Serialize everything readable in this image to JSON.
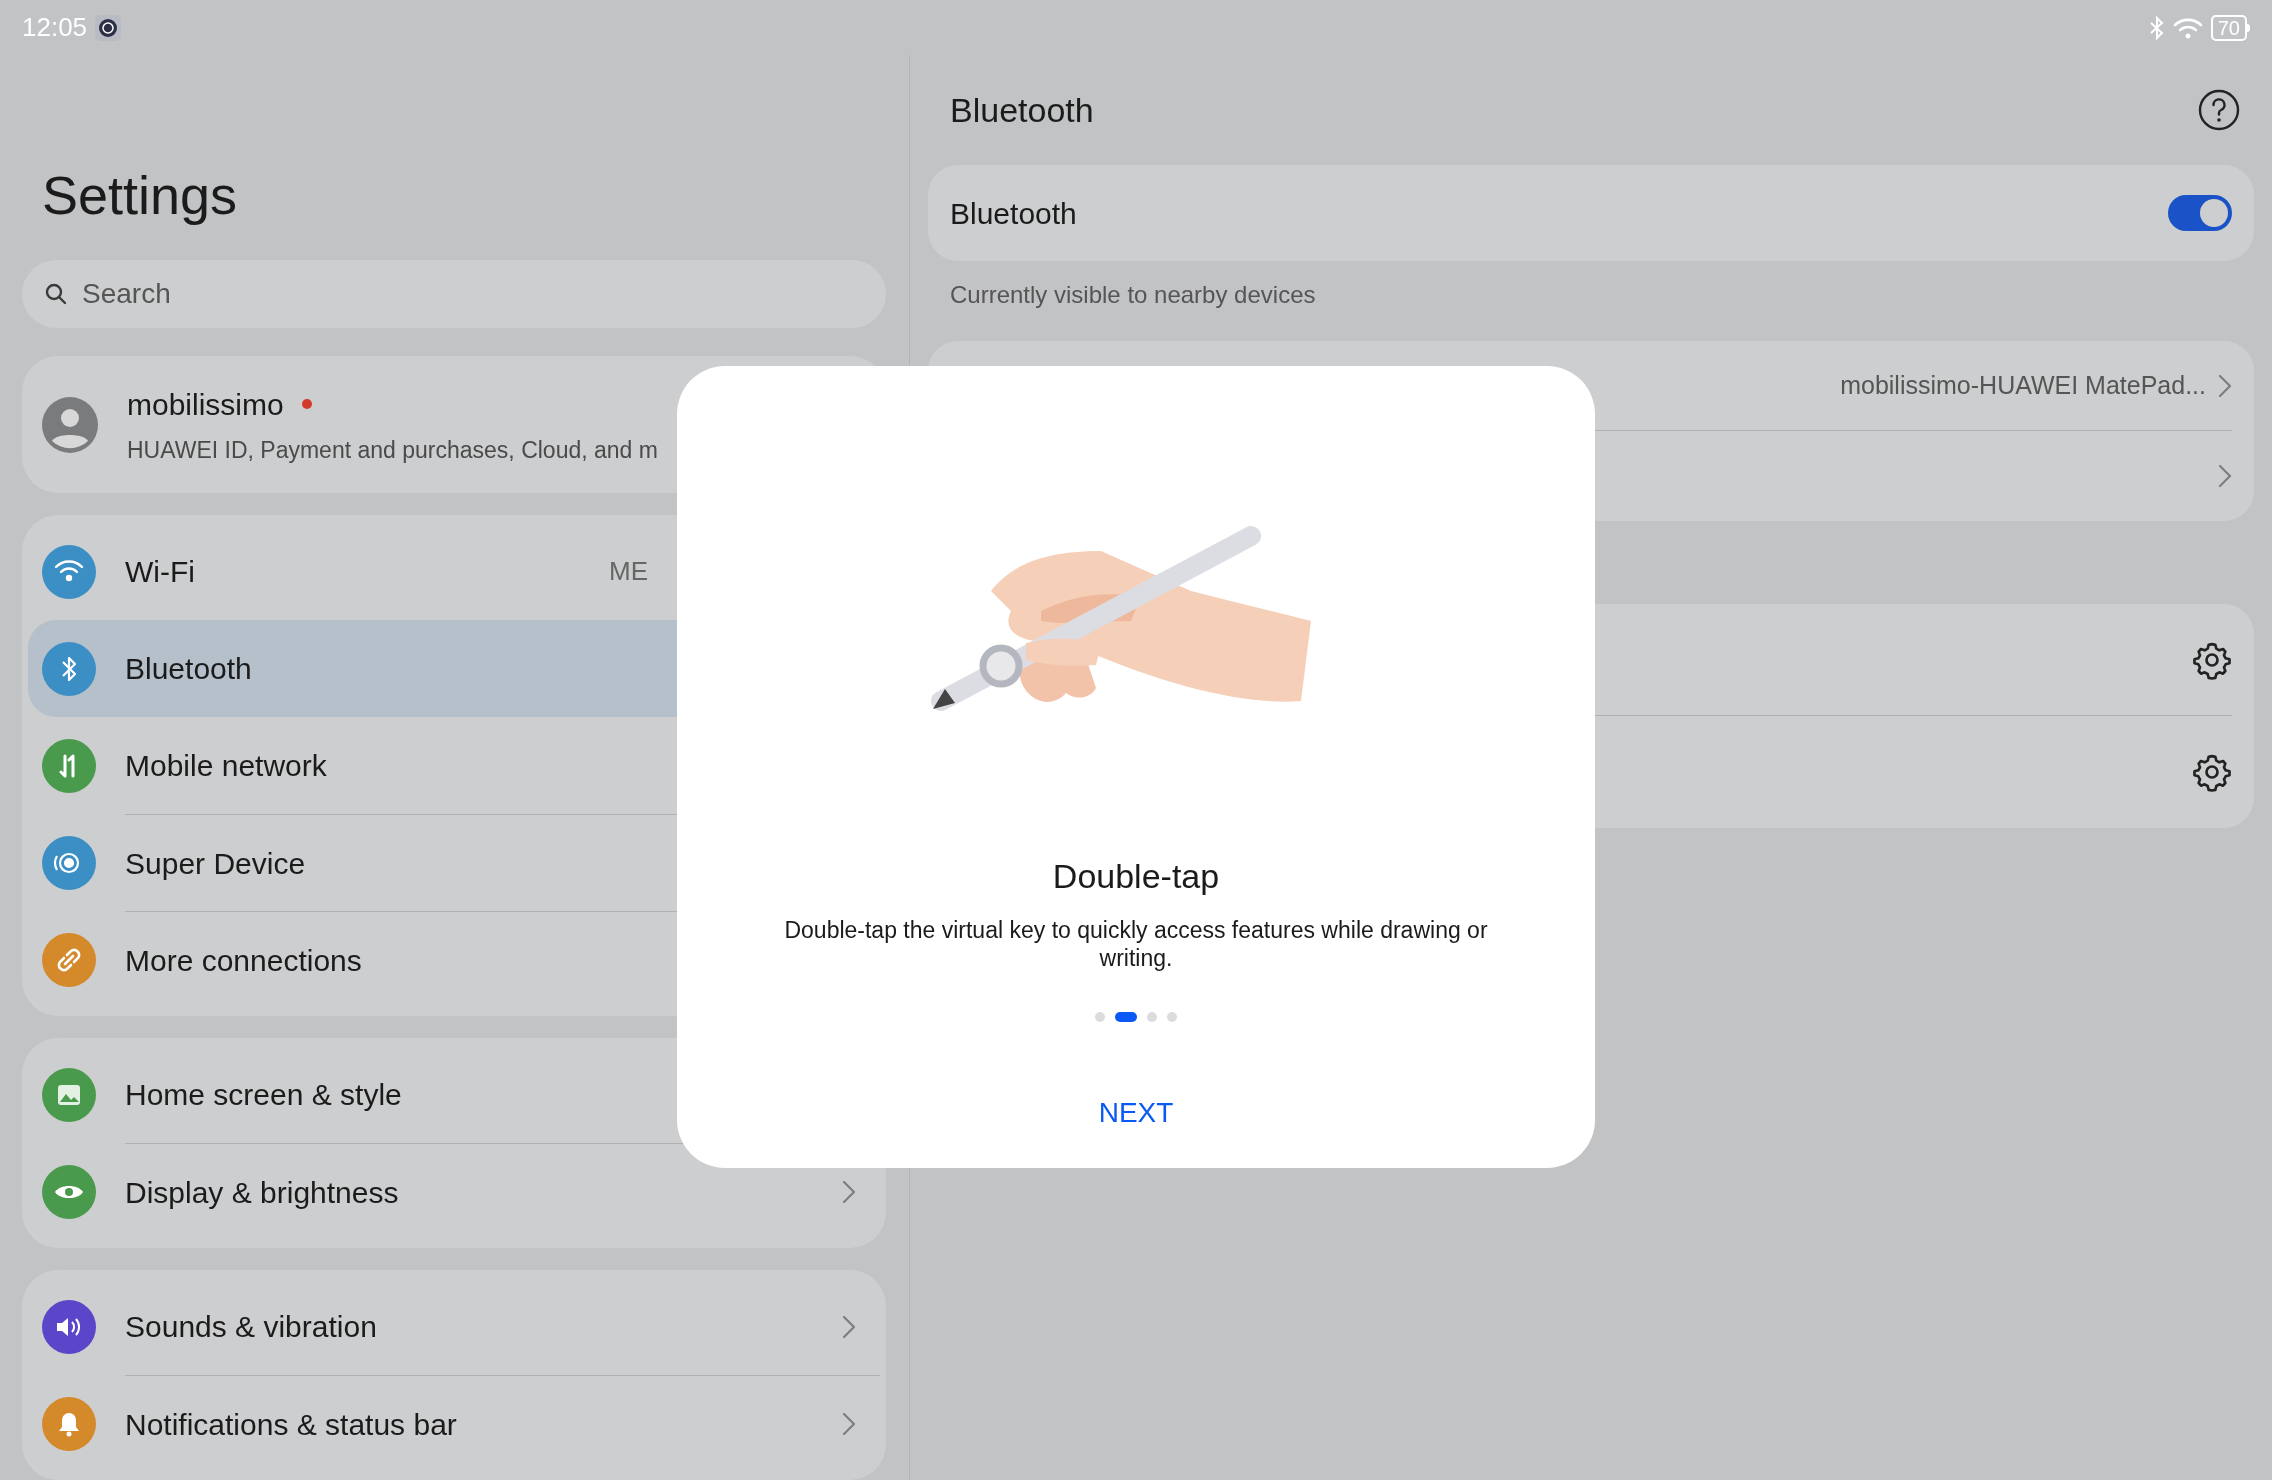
{
  "status_bar": {
    "time": "12:05",
    "battery": "70"
  },
  "settings": {
    "title": "Settings",
    "search": {
      "placeholder": "Search"
    },
    "profile": {
      "name": "mobilissimo",
      "notification_dot": true,
      "subtitle": "HUAWEI ID, Payment and purchases, Cloud, and m"
    },
    "groups": [
      [
        {
          "label": "Wi-Fi",
          "value": "ME",
          "selected": false,
          "color": "#3b8fc4",
          "chevron": false
        },
        {
          "label": "Bluetooth",
          "selected": true,
          "color": "#3b8fc4",
          "chevron": false
        },
        {
          "label": "Mobile network",
          "selected": false,
          "color": "#4a9a4e",
          "chevron": false
        },
        {
          "label": "Super Device",
          "selected": false,
          "color": "#3b8fc4",
          "chevron": false
        },
        {
          "label": "More connections",
          "selected": false,
          "color": "#d4892a",
          "chevron": false
        }
      ],
      [
        {
          "label": "Home screen & style",
          "selected": false,
          "color": "#4a9a4e",
          "chevron": false
        },
        {
          "label": "Display & brightness",
          "selected": false,
          "color": "#4a9a4e",
          "chevron": true
        }
      ],
      [
        {
          "label": "Sounds & vibration",
          "selected": false,
          "color": "#5b45c9",
          "chevron": true
        },
        {
          "label": "Notifications & status bar",
          "selected": false,
          "color": "#d4892a",
          "chevron": true
        }
      ]
    ]
  },
  "bluetooth": {
    "title": "Bluetooth",
    "toggle": {
      "label": "Bluetooth",
      "on": true
    },
    "visibility_note": "Currently visible to nearby devices",
    "device_name": "mobilissimo-HUAWEI MatePad..."
  },
  "dialog": {
    "title": "Double-tap",
    "body": "Double-tap the virtual key to quickly access features while drawing or writing.",
    "pages": [
      {
        "selected": false
      },
      {
        "selected": true
      },
      {
        "selected": false
      },
      {
        "selected": false
      }
    ],
    "button": "NEXT"
  }
}
